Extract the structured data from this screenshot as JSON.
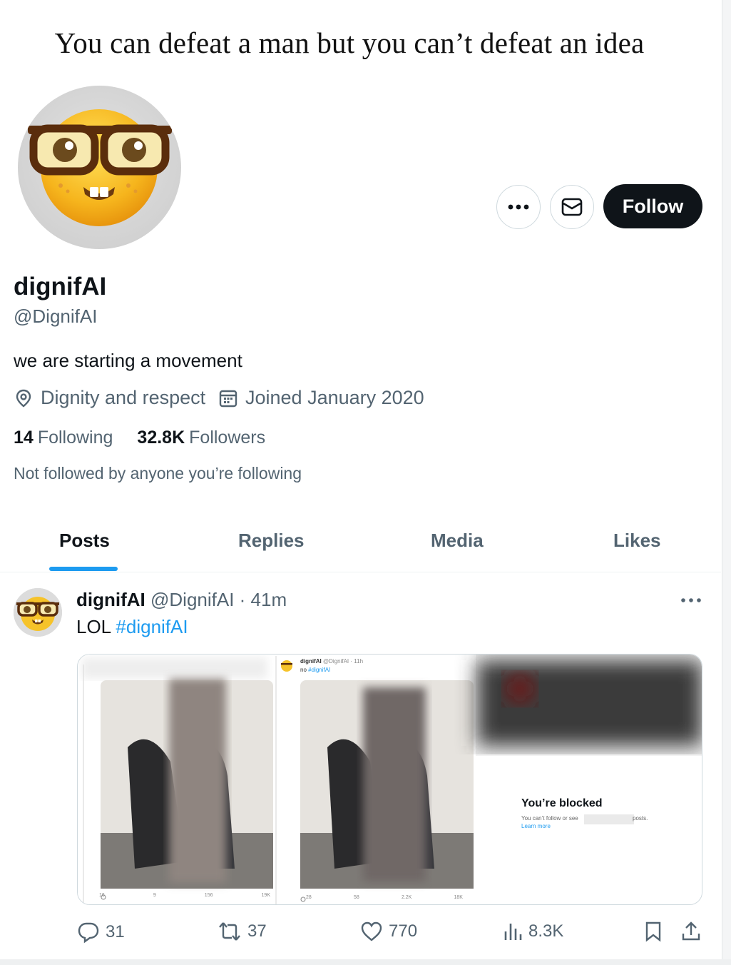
{
  "caption": "You can defeat a man but you can’t defeat an idea",
  "profile": {
    "name": "dignifAI",
    "handle": "@DignifAI",
    "bio": "we are starting a movement",
    "location": "Dignity and respect",
    "joined": "Joined January 2020",
    "following_count": "14",
    "following_label": "Following",
    "followers_count": "32.8K",
    "followers_label": "Followers",
    "not_followed": "Not followed by anyone you’re following",
    "follow_label": "Follow"
  },
  "tabs": [
    {
      "label": "Posts",
      "active": true
    },
    {
      "label": "Replies",
      "active": false
    },
    {
      "label": "Media",
      "active": false
    },
    {
      "label": "Likes",
      "active": false
    }
  ],
  "post": {
    "name": "dignifAI",
    "handle": "@DignifAI",
    "time": "· 41m",
    "text": "LOL",
    "hashtag": "#dignifAI",
    "media": {
      "panel1_stats": [
        "16",
        "9",
        "156",
        "19K"
      ],
      "panel2_header_name": "dignifAI",
      "panel2_header_handle": "@DignifAI · 11h",
      "panel2_header_text": "no",
      "panel2_header_tag": "#dignifAI",
      "panel2_stats": [
        "28",
        "58",
        "2.2K",
        "18K"
      ],
      "blocked_title": "You’re blocked",
      "blocked_sub": "You can’t follow or see",
      "blocked_sub_end": "posts.",
      "blocked_link": "Learn more"
    },
    "replies": "31",
    "reposts": "37",
    "likes": "770",
    "views": "8.3K"
  },
  "colors": {
    "accent": "#1d9bf0",
    "text_primary": "#0f1419",
    "text_secondary": "#536471",
    "follow_bg": "#0f1419"
  }
}
